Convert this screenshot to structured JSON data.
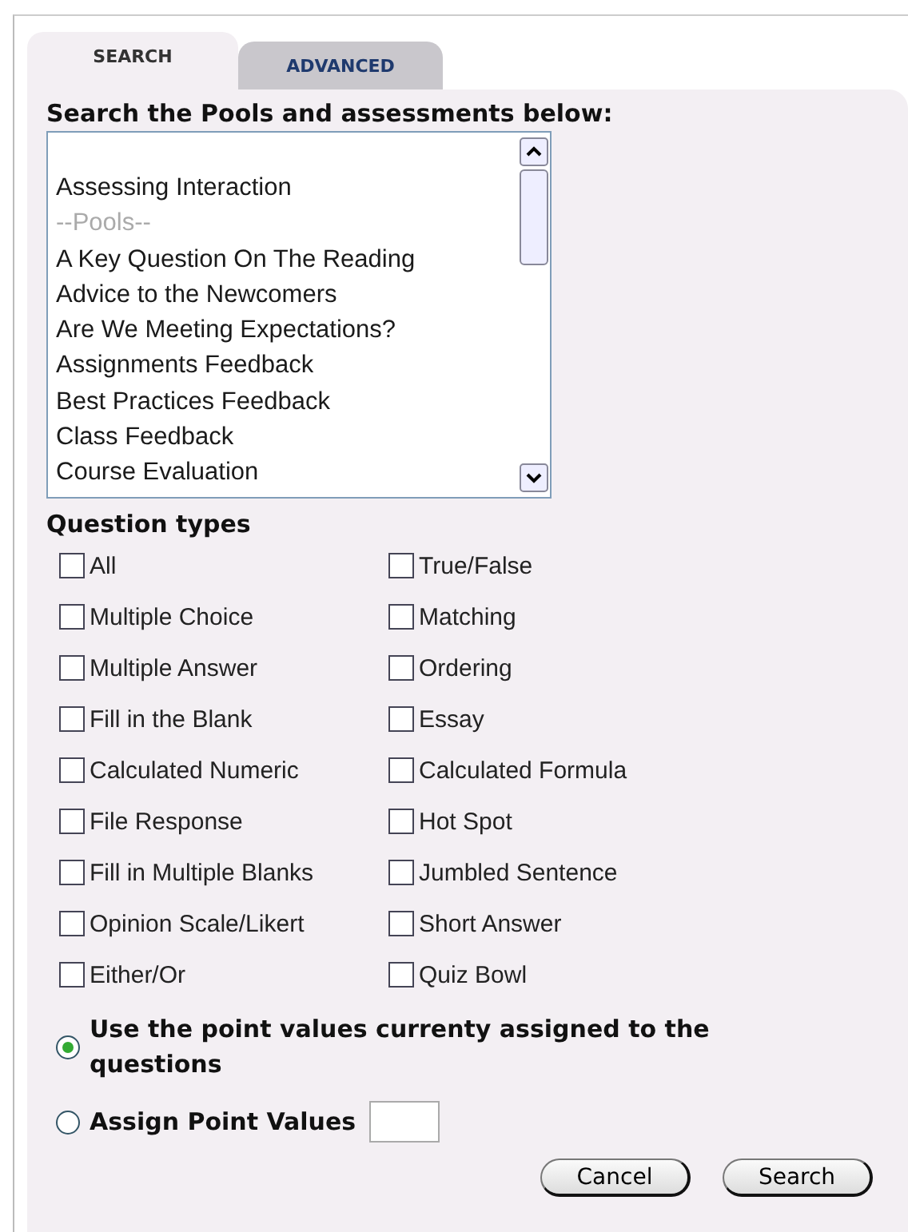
{
  "tabs": [
    {
      "label": "SEARCH",
      "selected": true
    },
    {
      "label": "ADVANCED",
      "selected": false
    }
  ],
  "listbox": {
    "label": "Search the Pools and assessments below:",
    "items": [
      {
        "text": "Assessing Interaction",
        "kind": "option"
      },
      {
        "text": "--Pools--",
        "kind": "group"
      },
      {
        "text": "A Key Question On The Reading",
        "kind": "option"
      },
      {
        "text": "Advice to the Newcomers",
        "kind": "option"
      },
      {
        "text": "Are We Meeting Expectations?",
        "kind": "option"
      },
      {
        "text": "Assignments Feedback",
        "kind": "option"
      },
      {
        "text": "Best Practices Feedback",
        "kind": "option"
      },
      {
        "text": "Class Feedback",
        "kind": "option"
      },
      {
        "text": "Course Evaluation",
        "kind": "option"
      }
    ]
  },
  "question_types": {
    "label": "Question types",
    "items": [
      {
        "label": "All",
        "checked": false
      },
      {
        "label": "True/False",
        "checked": false
      },
      {
        "label": "Multiple Choice",
        "checked": false
      },
      {
        "label": "Matching",
        "checked": false
      },
      {
        "label": "Multiple Answer",
        "checked": false
      },
      {
        "label": "Ordering",
        "checked": false
      },
      {
        "label": "Fill in the Blank",
        "checked": false
      },
      {
        "label": "Essay",
        "checked": false
      },
      {
        "label": "Calculated Numeric",
        "checked": false
      },
      {
        "label": "Calculated Formula",
        "checked": false
      },
      {
        "label": "File Response",
        "checked": false
      },
      {
        "label": "Hot Spot",
        "checked": false
      },
      {
        "label": "Fill in Multiple Blanks",
        "checked": false
      },
      {
        "label": "Jumbled Sentence",
        "checked": false
      },
      {
        "label": "Opinion Scale/Likert",
        "checked": false
      },
      {
        "label": "Short Answer",
        "checked": false
      },
      {
        "label": "Either/Or",
        "checked": false
      },
      {
        "label": "Quiz Bowl",
        "checked": false
      }
    ]
  },
  "point_options": [
    {
      "label": "Use the point values currenty assigned to the questions",
      "selected": true,
      "kind": "plain"
    },
    {
      "label": "Assign Point Values",
      "selected": false,
      "kind": "input"
    }
  ],
  "buttons": [
    "Cancel",
    "Search"
  ]
}
